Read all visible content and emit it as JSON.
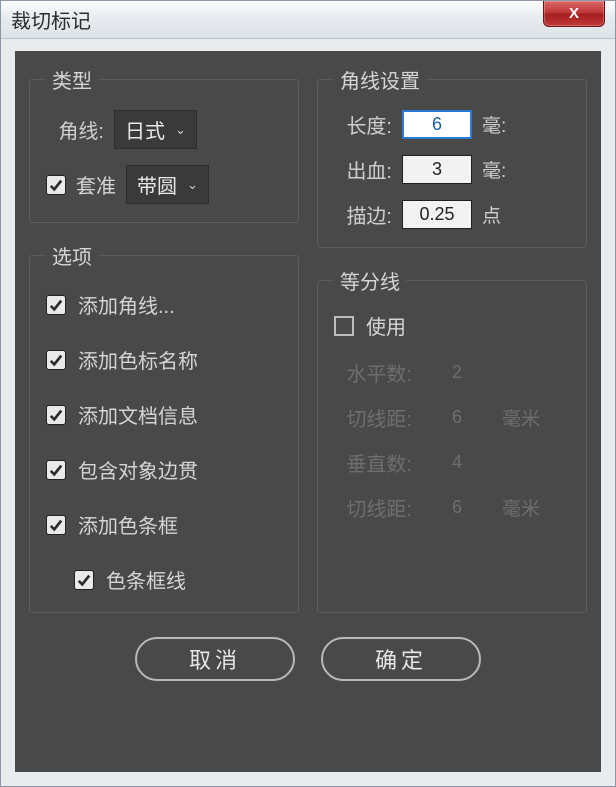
{
  "window": {
    "title": "裁切标记",
    "close": "X"
  },
  "type_group": {
    "legend": "类型",
    "corner_label": "角线:",
    "corner_value": "日式",
    "reg_label": "套准",
    "reg_checked": true,
    "reg_value": "带圆"
  },
  "corner_settings": {
    "legend": "角线设置",
    "length_label": "长度:",
    "length_value": "6",
    "length_unit": "毫:",
    "bleed_label": "出血:",
    "bleed_value": "3",
    "bleed_unit": "毫:",
    "stroke_label": "描边:",
    "stroke_value": "0.25",
    "stroke_unit": "点"
  },
  "options": {
    "legend": "选项",
    "items": [
      {
        "label": "添加角线...",
        "checked": true,
        "indent": false
      },
      {
        "label": "添加色标名称",
        "checked": true,
        "indent": false
      },
      {
        "label": "添加文档信息",
        "checked": true,
        "indent": false
      },
      {
        "label": "包含对象边贯",
        "checked": true,
        "indent": false
      },
      {
        "label": "添加色条框",
        "checked": true,
        "indent": false
      },
      {
        "label": "色条框线",
        "checked": true,
        "indent": true
      }
    ]
  },
  "dividers": {
    "legend": "等分线",
    "use_label": "使用",
    "use_checked": false,
    "rows": [
      {
        "label": "水平数:",
        "value": "2",
        "unit": ""
      },
      {
        "label": "切线距:",
        "value": "6",
        "unit": "毫米"
      },
      {
        "label": "垂直数:",
        "value": "4",
        "unit": ""
      },
      {
        "label": "切线距:",
        "value": "6",
        "unit": "毫米"
      }
    ]
  },
  "buttons": {
    "cancel": "取消",
    "ok": "确定"
  }
}
